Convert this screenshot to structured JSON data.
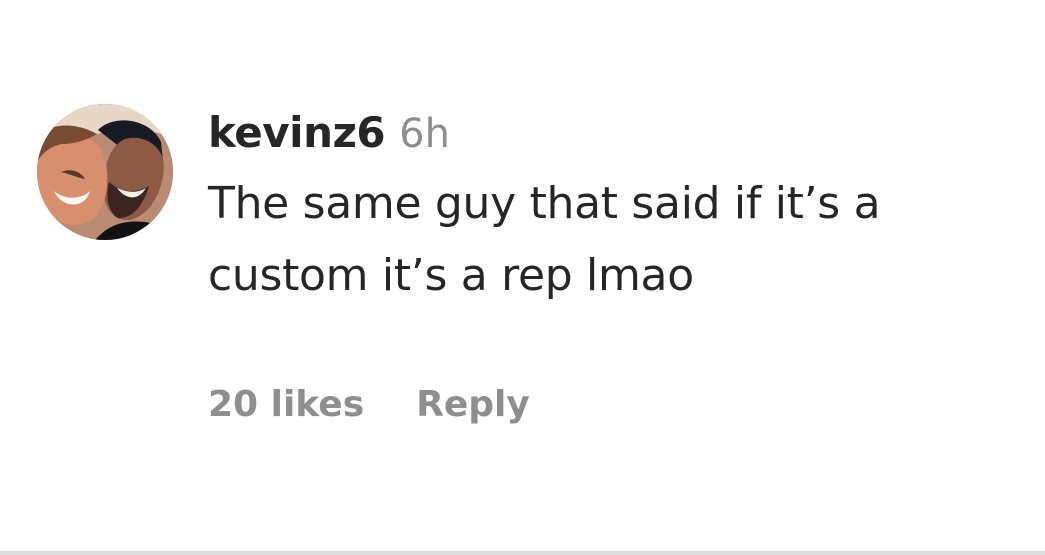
{
  "comment": {
    "username": "kevinz6",
    "timestamp": "6h",
    "text": "The same guy that said if it’s a custom it’s a rep lmao",
    "likes_label": "20 likes",
    "reply_label": "Reply"
  },
  "avatar": {
    "icon": "profile-photo-avatar"
  },
  "colors": {
    "text": "#262626",
    "muted": "#8e8e8e",
    "background": "#ffffff",
    "divider": "#dbdbdb"
  }
}
